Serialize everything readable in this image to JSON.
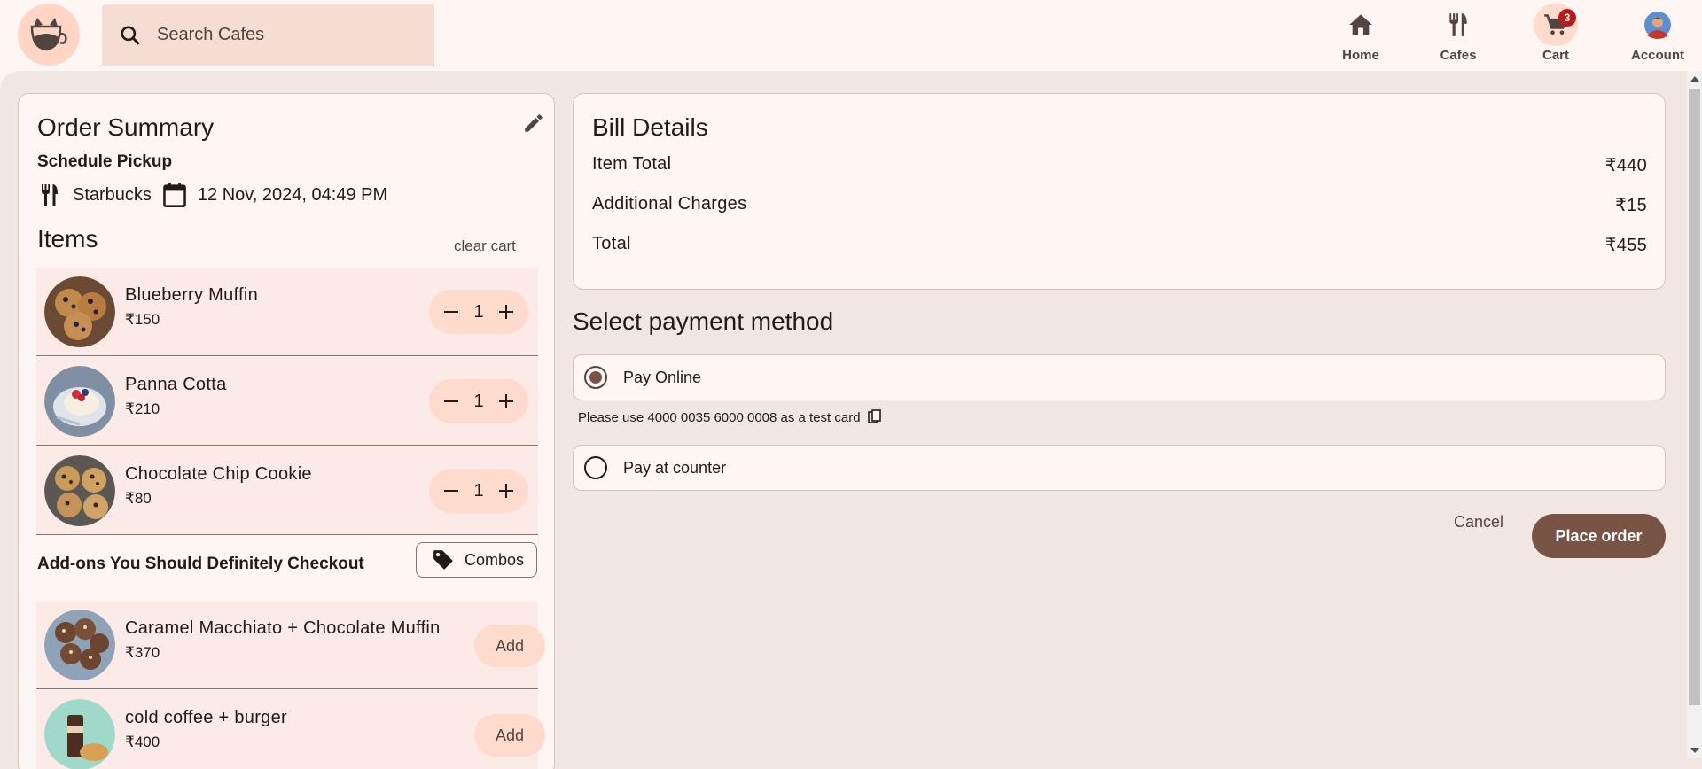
{
  "colors": {
    "background": "#fdf6f3",
    "surface": "#f2e6e3",
    "item_background": "#fbeae5",
    "accent_container": "#ffdbcd",
    "primary": "#775446",
    "badge": "#ba1a1a"
  },
  "header": {
    "logo_icon": "cat-cup-logo-icon",
    "search": {
      "placeholder": "Search Cafes",
      "icon": "search-icon"
    },
    "nav": [
      {
        "label": "Home",
        "icon": "home-icon"
      },
      {
        "label": "Cafes",
        "icon": "fork-knife-icon"
      },
      {
        "label": "Cart",
        "icon": "cart-icon",
        "badge": "3",
        "active": true
      },
      {
        "label": "Account",
        "icon": "avatar-icon"
      }
    ]
  },
  "order_summary": {
    "title": "Order Summary",
    "edit_icon": "pencil-icon",
    "schedule_label": "Schedule Pickup",
    "cafe": "Starbucks",
    "pickup_time": "12 Nov, 2024, 04:49 PM",
    "items_title": "Items",
    "clear_cart": "clear cart",
    "items": [
      {
        "name": "Blueberry Muffin",
        "price": "₹150",
        "qty": "1"
      },
      {
        "name": "Panna Cotta",
        "price": "₹210",
        "qty": "1"
      },
      {
        "name": "Chocolate Chip Cookie",
        "price": "₹80",
        "qty": "1"
      }
    ],
    "addons_title": "Add-ons You Should Definitely Checkout",
    "combos_label": "Combos",
    "addons": [
      {
        "name": "Caramel Macchiato + Chocolate Muffin",
        "price": "₹370",
        "action": "Add"
      },
      {
        "name": "cold coffee + burger",
        "price": "₹400",
        "action": "Add"
      }
    ]
  },
  "bill": {
    "title": "Bill Details",
    "rows": [
      {
        "label": "Item Total",
        "value": "₹440"
      },
      {
        "label": "Additional Charges",
        "value": "₹15"
      },
      {
        "label": "Total",
        "value": "₹455"
      }
    ]
  },
  "payment": {
    "title": "Select payment method",
    "options": [
      {
        "label": "Pay Online",
        "selected": true
      },
      {
        "label": "Pay at counter",
        "selected": false
      }
    ],
    "hint": "Please use 4000 0035 6000 0008 as a test card",
    "cancel": "Cancel",
    "place_order": "Place order"
  }
}
